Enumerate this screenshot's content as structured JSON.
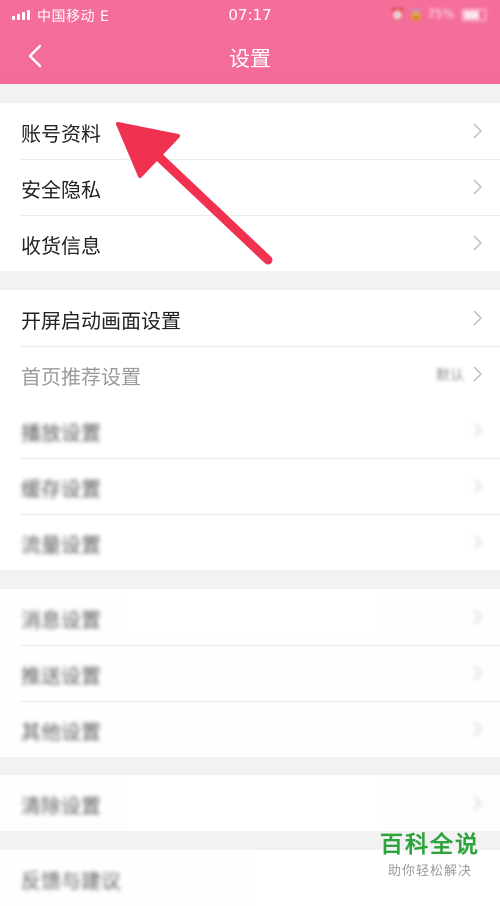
{
  "status_bar": {
    "carrier": "中国移动  E",
    "time": "07:17",
    "battery_text": "75%"
  },
  "header": {
    "title": "设置",
    "back_icon": "chevron-left-icon"
  },
  "groups": [
    {
      "items": [
        {
          "label": "账号资料"
        },
        {
          "label": "安全隐私"
        },
        {
          "label": "收货信息"
        }
      ]
    },
    {
      "items": [
        {
          "label": "开屏启动画面设置"
        },
        {
          "label": "首页推荐设置",
          "value": "默认"
        },
        {
          "label": "播放设置"
        },
        {
          "label": "缓存设置"
        },
        {
          "label": "流量设置"
        }
      ]
    },
    {
      "items": [
        {
          "label": "消息设置"
        },
        {
          "label": "推送设置"
        },
        {
          "label": "其他设置"
        }
      ]
    },
    {
      "items": [
        {
          "label": "清除设置"
        }
      ]
    },
    {
      "items": [
        {
          "label": "反馈与建议"
        }
      ]
    }
  ],
  "annotation": {
    "arrow_color": "#f0314f"
  },
  "watermark": {
    "title": "百科全说",
    "subtitle": "助你轻松解决"
  },
  "colors": {
    "header": "#f46d98",
    "background": "#f2f2f2",
    "watermark_green": "#2da33e"
  }
}
